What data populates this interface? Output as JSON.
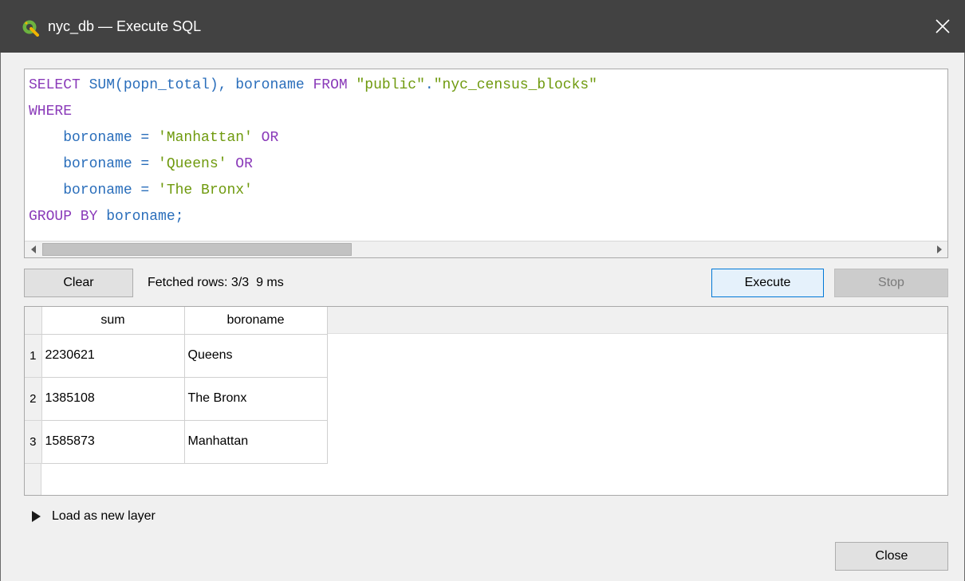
{
  "window": {
    "title": "nyc_db — Execute SQL",
    "app_icon": "qgis-logo-icon",
    "close_icon": "close-icon"
  },
  "editor": {
    "lines": [
      [
        {
          "t": "kw",
          "v": "SELECT"
        },
        {
          "t": "plain",
          "v": " SUM(popn_total), boroname "
        },
        {
          "t": "kw",
          "v": "FROM"
        },
        {
          "t": "plain",
          "v": " "
        },
        {
          "t": "str",
          "v": "\"public\""
        },
        {
          "t": "plain",
          "v": "."
        },
        {
          "t": "str",
          "v": "\"nyc_census_blocks\""
        }
      ],
      [
        {
          "t": "kw",
          "v": "WHERE"
        }
      ],
      [
        {
          "t": "plain",
          "v": "    boroname = "
        },
        {
          "t": "str",
          "v": "'Manhattan'"
        },
        {
          "t": "plain",
          "v": " "
        },
        {
          "t": "kw",
          "v": "OR"
        }
      ],
      [
        {
          "t": "plain",
          "v": "    boroname = "
        },
        {
          "t": "str",
          "v": "'Queens'"
        },
        {
          "t": "plain",
          "v": " "
        },
        {
          "t": "kw",
          "v": "OR"
        }
      ],
      [
        {
          "t": "plain",
          "v": "    boroname = "
        },
        {
          "t": "str",
          "v": "'The Bronx'"
        }
      ],
      [
        {
          "t": "kw",
          "v": "GROUP BY"
        },
        {
          "t": "plain",
          "v": " boroname;"
        }
      ]
    ]
  },
  "toolbar": {
    "clear_label": "Clear",
    "status": "Fetched rows: 3/3  9 ms",
    "execute_label": "Execute",
    "stop_label": "Stop"
  },
  "results": {
    "columns": [
      "sum",
      "boroname"
    ],
    "rows": [
      {
        "n": "1",
        "sum": "2230621",
        "boroname": "Queens"
      },
      {
        "n": "2",
        "sum": "1385108",
        "boroname": "The Bronx"
      },
      {
        "n": "3",
        "sum": "1585873",
        "boroname": "Manhattan"
      }
    ]
  },
  "footer": {
    "load_layer_label": "Load as new layer",
    "close_label": "Close"
  },
  "colors": {
    "titlebar": "#424242",
    "keyword": "#8a3ab9",
    "string": "#6f9a0e",
    "identifier": "#2a6ebb"
  }
}
